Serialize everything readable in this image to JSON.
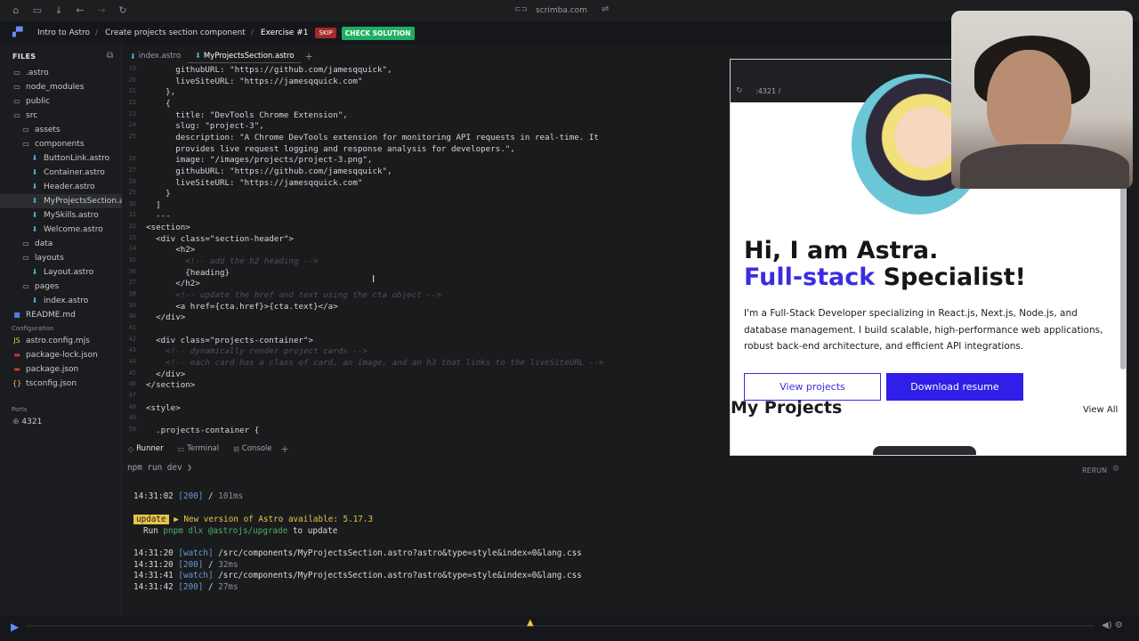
{
  "browser": {
    "url": "scrimba.com"
  },
  "breadcrumb": {
    "course": "Intro to Astro",
    "lesson": "Create projects section component",
    "exercise": "Exercise #1",
    "skip_label": "SKIP",
    "check_label": "CHECK SOLUTION"
  },
  "sidebar": {
    "header": "FILES",
    "items": [
      {
        "label": ".astro",
        "type": "folder",
        "indent": 0
      },
      {
        "label": "node_modules",
        "type": "folder",
        "indent": 0
      },
      {
        "label": "public",
        "type": "folder",
        "indent": 0
      },
      {
        "label": "src",
        "type": "folder",
        "indent": 0
      },
      {
        "label": "assets",
        "type": "folder",
        "indent": 1
      },
      {
        "label": "components",
        "type": "folder",
        "indent": 1
      },
      {
        "label": "ButtonLink.astro",
        "type": "astro",
        "indent": 2
      },
      {
        "label": "Container.astro",
        "type": "astro",
        "indent": 2
      },
      {
        "label": "Header.astro",
        "type": "astro",
        "indent": 2
      },
      {
        "label": "MyProjectsSection.as",
        "type": "astro",
        "indent": 2,
        "selected": true
      },
      {
        "label": "MySkills.astro",
        "type": "astro",
        "indent": 2
      },
      {
        "label": "Welcome.astro",
        "type": "astro",
        "indent": 2
      },
      {
        "label": "data",
        "type": "folder",
        "indent": 1
      },
      {
        "label": "layouts",
        "type": "folder",
        "indent": 1
      },
      {
        "label": "Layout.astro",
        "type": "astro",
        "indent": 2
      },
      {
        "label": "pages",
        "type": "folder",
        "indent": 1
      },
      {
        "label": "index.astro",
        "type": "astro",
        "indent": 2
      },
      {
        "label": "README.md",
        "type": "readme",
        "indent": 0
      }
    ],
    "config_header": "Configuration",
    "config_items": [
      {
        "label": "astro.config.mjs",
        "icon": "js-icon",
        "color": "#e8c547"
      },
      {
        "label": "package-lock.json",
        "icon": "npm-icon",
        "color": "#c93b3b"
      },
      {
        "label": "package.json",
        "icon": "npm-icon",
        "color": "#c93b3b"
      },
      {
        "label": "tsconfig.json",
        "icon": "braces-icon",
        "color": "#e8c547"
      }
    ],
    "ports_header": "Ports",
    "port": "4321"
  },
  "editor": {
    "tabs": [
      {
        "label": "index.astro",
        "active": false
      },
      {
        "label": "MyProjectsSection.astro",
        "active": true
      }
    ],
    "lines": [
      {
        "n": "19",
        "text": "      githubURL: \"https://github.com/jamesqquick\","
      },
      {
        "n": "20",
        "text": "      liveSiteURL: \"https://jamesqquick.com\""
      },
      {
        "n": "21",
        "text": "    },"
      },
      {
        "n": "22",
        "text": "    {"
      },
      {
        "n": "23",
        "text": "      title: \"DevTools Chrome Extension\","
      },
      {
        "n": "24",
        "text": "      slug: \"project-3\","
      },
      {
        "n": "25",
        "text": "      description: \"A Chrome DevTools extension for monitoring API requests in real-time. It"
      },
      {
        "n": "",
        "text": "      provides live request logging and response analysis for developers.\","
      },
      {
        "n": "26",
        "text": "      image: \"/images/projects/project-3.png\","
      },
      {
        "n": "27",
        "text": "      githubURL: \"https://github.com/jamesqquick\","
      },
      {
        "n": "28",
        "text": "      liveSiteURL: \"https://jamesqquick.com\""
      },
      {
        "n": "29",
        "text": "    }"
      },
      {
        "n": "30",
        "text": "  ]"
      },
      {
        "n": "31",
        "text": "  ---"
      },
      {
        "n": "32",
        "text": "<section>"
      },
      {
        "n": "33",
        "text": "  <div class=\"section-header\">"
      },
      {
        "n": "34",
        "text": "      <h2>"
      },
      {
        "n": "35",
        "text": "        <!-- add the h2 heading -->",
        "comment": true
      },
      {
        "n": "36",
        "text": "        {heading}"
      },
      {
        "n": "37",
        "text": "      </h2>"
      },
      {
        "n": "38",
        "text": "      <!-- update the href and text using the cta object -->",
        "comment": true
      },
      {
        "n": "39",
        "text": "      <a href={cta.href}>{cta.text}</a>"
      },
      {
        "n": "40",
        "text": "  </div>"
      },
      {
        "n": "41",
        "text": ""
      },
      {
        "n": "42",
        "text": "  <div class=\"projects-container\">"
      },
      {
        "n": "43",
        "text": "    <!-- dynamically render project cards -->",
        "comment": true
      },
      {
        "n": "44",
        "text": "    <!-- each card has a class of card, an image, and an h3 that links to the liveSiteURL -->",
        "comment": true
      },
      {
        "n": "45",
        "text": "  </div>"
      },
      {
        "n": "46",
        "text": "</section>"
      },
      {
        "n": "47",
        "text": ""
      },
      {
        "n": "48",
        "text": "<style>"
      },
      {
        "n": "49",
        "text": ""
      },
      {
        "n": "50",
        "text": "  .projects-container {"
      }
    ]
  },
  "panel": {
    "tabs": [
      {
        "label": "Runner",
        "icon": "diamond-icon",
        "active": true
      },
      {
        "label": "Terminal",
        "icon": "terminal-icon",
        "active": false
      },
      {
        "label": "Console",
        "icon": "console-icon",
        "active": false
      }
    ],
    "rerun_label": "RERUN",
    "command": "npm run dev",
    "log": [
      {
        "time": "14:31:02",
        "status": "[200]",
        "path": "/",
        "dur": "101ms"
      },
      {
        "badge": "update",
        "message": "▶ New version of Astro available: 5.17.3"
      },
      {
        "run_prefix": "Run",
        "run_cmd": "pnpm dlx @astrojs/upgrade",
        "run_suffix": "to update"
      },
      {
        "time": "14:31:20",
        "status": "[watch]",
        "path": "/src/components/MyProjectsSection.astro?astro&type=style&index=0&lang.css"
      },
      {
        "time": "14:31:20",
        "status": "[200]",
        "path": "/",
        "dur": "32ms"
      },
      {
        "time": "14:31:41",
        "status": "[watch]",
        "path": "/src/components/MyProjectsSection.astro?astro&type=style&index=0&lang.css"
      },
      {
        "time": "14:31:42",
        "status": "[200]",
        "path": "/",
        "dur": "27ms"
      }
    ]
  },
  "preview": {
    "url": ":4321 /",
    "hero_line1": "Hi, I am Astra.",
    "hero_accent": "Full-stack",
    "hero_line2_rest": " Specialist!",
    "description": "I'm a Full-Stack Developer specializing in React.js, Next.js, Node.js, and database management. I build scalable, high-performance web applications, robust back-end architecture, and efficient API integrations.",
    "btn_view": "View projects",
    "btn_resume": "Download resume",
    "projects_title": "My Projects",
    "view_all": "View All",
    "accent_color": "#3a2ee0"
  }
}
